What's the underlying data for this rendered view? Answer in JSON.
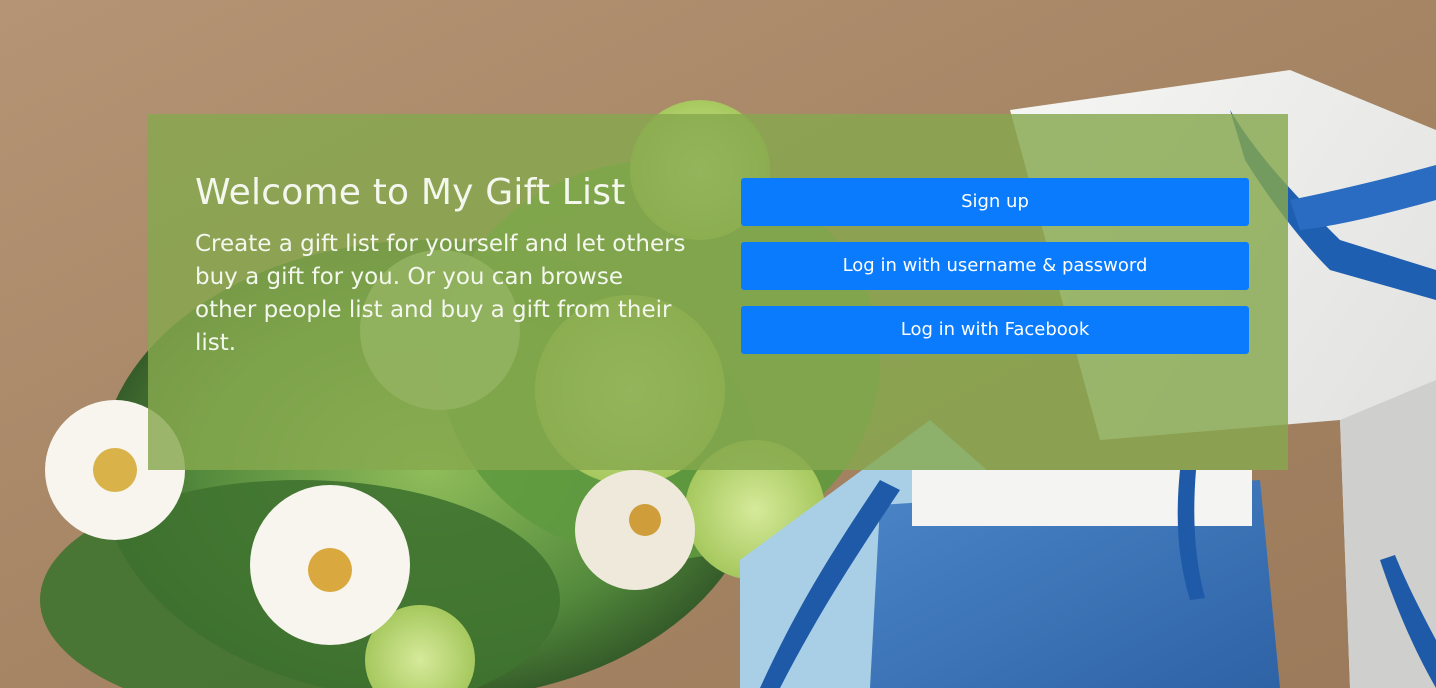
{
  "welcome": {
    "title": "Welcome to My Gift List",
    "description": "Create a gift list for yourself and let others buy a gift for you. Or you can browse other people list and buy a gift from their list."
  },
  "actions": {
    "signup_label": "Sign up",
    "login_password_label": "Log in with username & password",
    "login_facebook_label": "Log in with Facebook"
  },
  "theme": {
    "panel_color": "#86a84e",
    "button_color": "#0a7bfd",
    "button_text_color": "#ffffff",
    "panel_text_color": "#f4f7ee"
  },
  "background": {
    "image_subject": "flowers-and-gift-box-photo"
  }
}
